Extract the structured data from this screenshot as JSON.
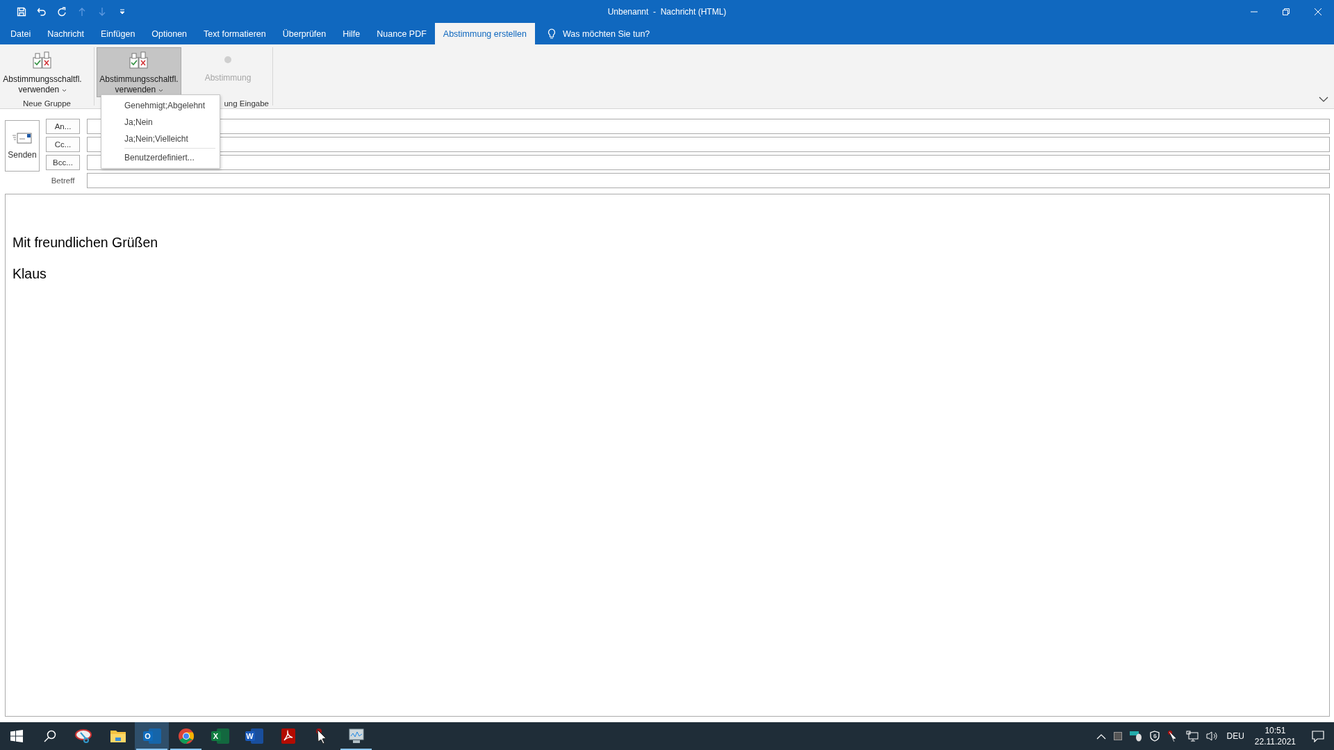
{
  "quick_access": [
    {
      "kind": "save",
      "disabled": false
    },
    {
      "kind": "undo",
      "disabled": false
    },
    {
      "kind": "redo",
      "disabled": false
    },
    {
      "kind": "up",
      "disabled": true
    },
    {
      "kind": "down",
      "disabled": true
    },
    {
      "kind": "customize",
      "disabled": false
    }
  ],
  "window": {
    "title": "Unbenannt  -  Nachricht (HTML)"
  },
  "tabs": [
    {
      "label": "Datei",
      "selected": false
    },
    {
      "label": "Nachricht",
      "selected": false
    },
    {
      "label": "Einfügen",
      "selected": false
    },
    {
      "label": "Optionen",
      "selected": false
    },
    {
      "label": "Text formatieren",
      "selected": false
    },
    {
      "label": "Überprüfen",
      "selected": false
    },
    {
      "label": "Hilfe",
      "selected": false
    },
    {
      "label": "Nuance PDF",
      "selected": false
    },
    {
      "label": "Abstimmung erstellen",
      "selected": true
    }
  ],
  "tell_me": {
    "placeholder": "Was möchten Sie tun?"
  },
  "ribbon_groups": [
    {
      "label": "Neue Gruppe",
      "buttons": [
        {
          "kind": "ballot",
          "label": "Abstimmungsschaltfl.",
          "label2": "verwenden",
          "pressed": false,
          "disabled": false
        }
      ]
    },
    {
      "label": "ung Eingabe",
      "buttons": [
        {
          "kind": "ballot",
          "label": "Abstimmungsschaltfl.",
          "label2": "verwenden",
          "pressed": true,
          "disabled": false
        },
        {
          "kind": "dot",
          "label": "Abstimmung",
          "pressed": false,
          "disabled": true
        }
      ]
    }
  ],
  "dropdown": {
    "items": [
      {
        "label": "Genehmigt;Abgelehnt"
      },
      {
        "label": "Ja;Nein"
      },
      {
        "label": "Ja;Nein;Vielleicht"
      },
      {
        "label": "Benutzerdefiniert..."
      }
    ]
  },
  "send_button": {
    "label": "Senden"
  },
  "recipients": [
    {
      "button": "An..."
    },
    {
      "button": "Cc..."
    },
    {
      "button": "Bcc..."
    }
  ],
  "subject": {
    "label": "Betreff"
  },
  "body": {
    "lines": [
      "Mit freundlichen Grüßen",
      "Klaus"
    ]
  },
  "taskbar": {
    "apps": [
      {
        "kind": "snipping",
        "selected": false,
        "running": false
      },
      {
        "kind": "explorer",
        "selected": false,
        "running": false
      },
      {
        "kind": "outlook",
        "glyph": "O",
        "selected": true,
        "running": true
      },
      {
        "kind": "chrome",
        "selected": false,
        "running": true
      },
      {
        "kind": "excel",
        "glyph": "X",
        "selected": false,
        "running": false
      },
      {
        "kind": "word",
        "glyph": "W",
        "selected": false,
        "running": false
      },
      {
        "kind": "acrobat",
        "selected": false,
        "running": false
      },
      {
        "kind": "cursor",
        "selected": false,
        "running": false
      },
      {
        "kind": "monitor",
        "selected": false,
        "running": true
      }
    ],
    "tray": {
      "language": "DEU",
      "time": "10:51",
      "date": "22.11.2021"
    }
  }
}
